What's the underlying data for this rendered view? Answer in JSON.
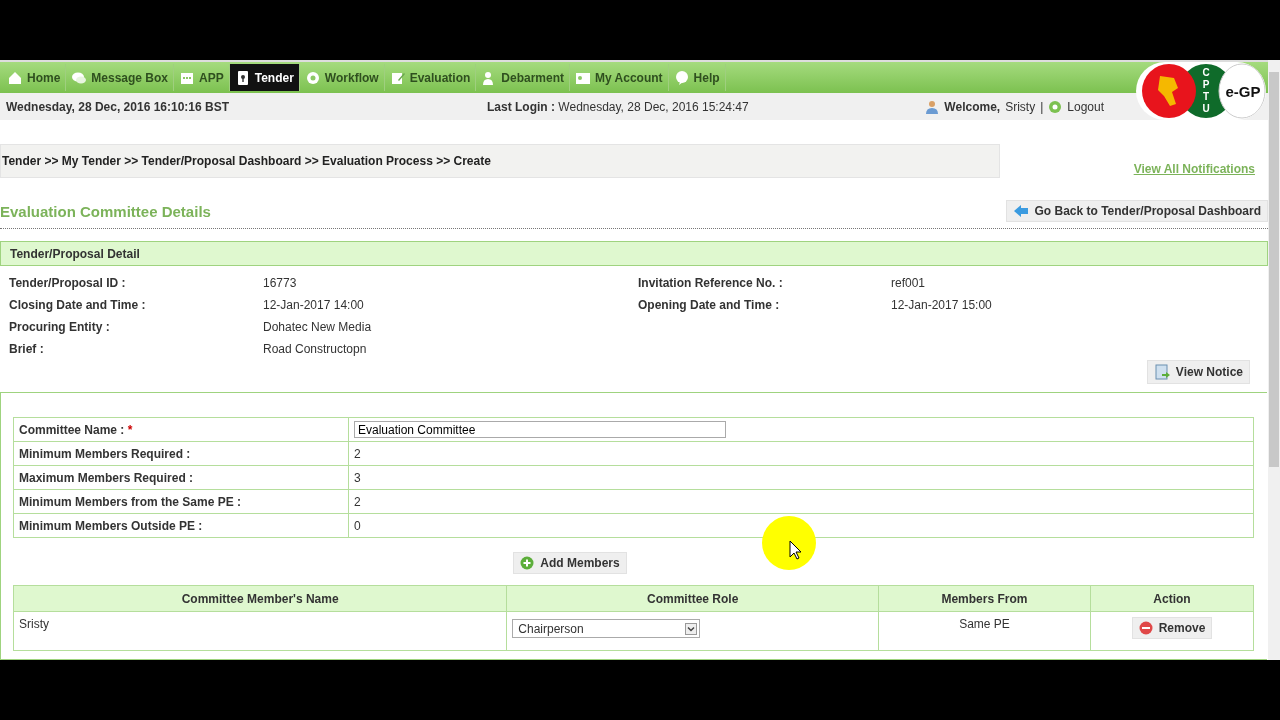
{
  "nav": {
    "items": [
      {
        "label": "Home",
        "selected": false
      },
      {
        "label": "Message Box",
        "selected": false
      },
      {
        "label": "APP",
        "selected": false
      },
      {
        "label": "Tender",
        "selected": true
      },
      {
        "label": "Workflow",
        "selected": false
      },
      {
        "label": "Evaluation",
        "selected": false
      },
      {
        "label": "Debarment",
        "selected": false
      },
      {
        "label": "My Account",
        "selected": false
      },
      {
        "label": "Help",
        "selected": false
      }
    ]
  },
  "info_bar": {
    "date": "Wednesday, 28 Dec, 2016 16:10:16 BST",
    "last_login_label": "Last Login :",
    "last_login_value": "Wednesday, 28 Dec, 2016 15:24:47",
    "welcome_label": "Welcome,",
    "user": "Sristy",
    "separator": "|",
    "logout": "Logout"
  },
  "logo": {
    "letters": [
      "C",
      "P",
      "T",
      "U"
    ],
    "name": "e-GP"
  },
  "breadcrumb": "Tender >> My Tender >> Tender/Proposal Dashboard >> Evaluation Process >> Create",
  "notifications_link": "View All Notifications",
  "heading": "Evaluation Committee Details",
  "back_button": "Go Back to Tender/Proposal Dashboard",
  "detail": {
    "title": "Tender/Proposal Detail",
    "rows": [
      {
        "label": "Tender/Proposal ID :",
        "value": "16773",
        "label_2": "Invitation Reference No. :",
        "value_2": "ref001"
      },
      {
        "label": "Closing Date and Time :",
        "value": "12-Jan-2017 14:00",
        "label_2": "Opening Date and Time :",
        "value_2": "12-Jan-2017 15:00"
      },
      {
        "label": "Procuring Entity :",
        "value": "Dohatec New Media"
      },
      {
        "label": "Brief :",
        "value": "Road Constructopn"
      }
    ]
  },
  "view_notice": "View Notice",
  "committee_form": {
    "rows": [
      {
        "kind": "input",
        "label": "Committee Name :",
        "required_mark": "*",
        "value": "Evaluation Committee"
      },
      {
        "kind": "text",
        "label": "Minimum Members Required :",
        "value": "2"
      },
      {
        "kind": "text",
        "label": "Maximum Members Required :",
        "value": "3"
      },
      {
        "kind": "text",
        "label": "Minimum Members from the Same PE :",
        "value": "2"
      },
      {
        "kind": "text",
        "label": "Minimum Members Outside PE :",
        "value": "0"
      }
    ]
  },
  "add_members": "Add Members",
  "members": {
    "columns": [
      "Committee Member's Name",
      "Committee Role",
      "Members From",
      "Action"
    ],
    "rows": [
      {
        "name": "Sristy",
        "role": "Chairperson",
        "from": "Same PE",
        "action": "Remove"
      }
    ]
  }
}
